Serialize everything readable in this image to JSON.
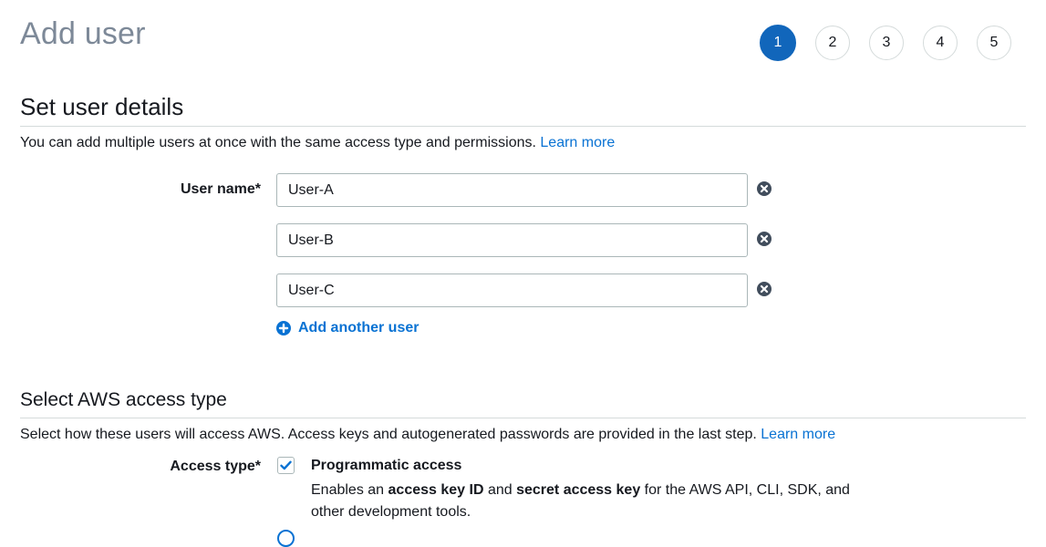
{
  "page": {
    "title": "Add user"
  },
  "steps": [
    "1",
    "2",
    "3",
    "4",
    "5"
  ],
  "details": {
    "heading": "Set user details",
    "description": "You can add multiple users at once with the same access type and permissions.",
    "learn_more": "Learn more",
    "user_name_label": "User name*",
    "users": [
      "User-A",
      "User-B",
      "User-C"
    ],
    "add_another": "Add another user"
  },
  "access": {
    "heading": "Select AWS access type",
    "description": "Select how these users will access AWS. Access keys and autogenerated passwords are provided in the last step.",
    "learn_more": "Learn more",
    "label": "Access type*",
    "option": {
      "title": "Programmatic access",
      "checked": true,
      "desc_1": "Enables an ",
      "desc_bold_1": "access key ID",
      "desc_2": " and ",
      "desc_bold_2": "secret access key",
      "desc_3": " for the AWS API, CLI, SDK, and other development tools."
    }
  },
  "colors": {
    "accent": "#1166bb",
    "link": "#0972d3",
    "title": "#7d8998",
    "border": "#aab7b8"
  },
  "icons": {
    "remove": "close-circle-icon",
    "add": "plus-circle-icon",
    "check": "checkmark-icon"
  }
}
